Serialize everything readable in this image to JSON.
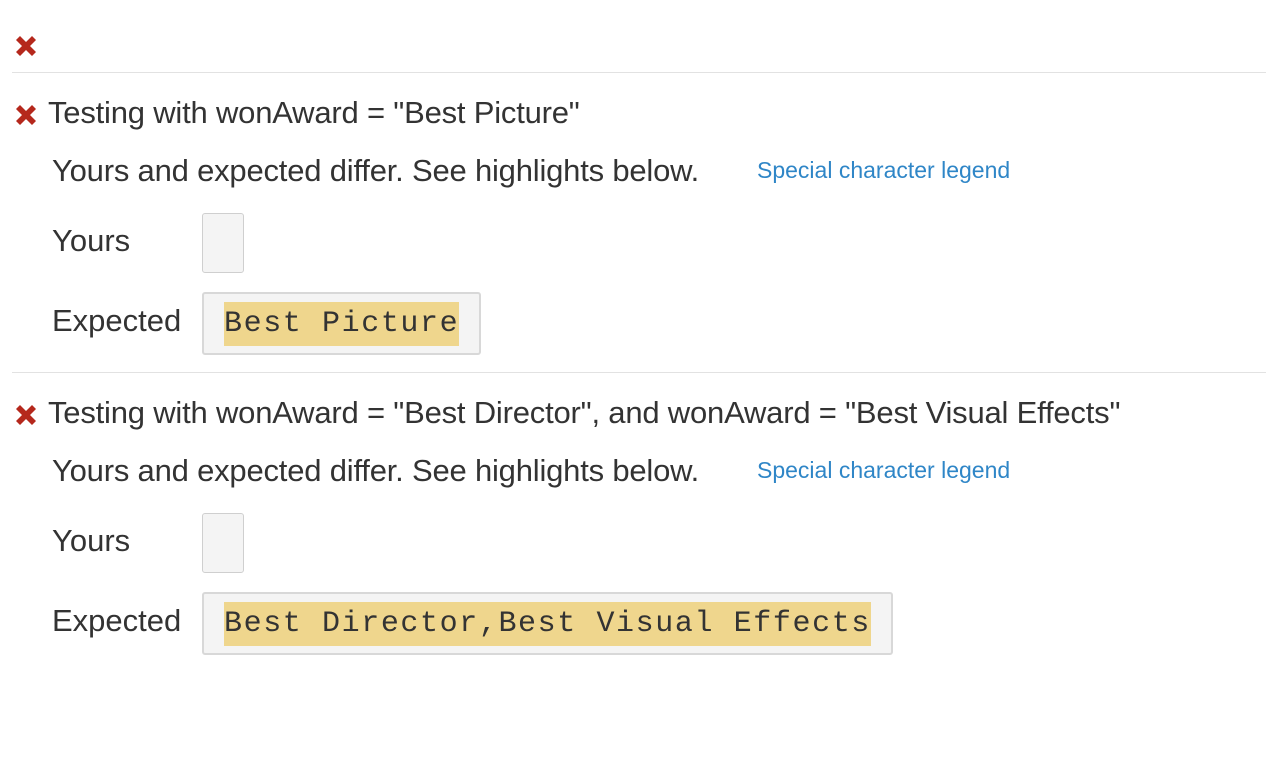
{
  "colors": {
    "error_icon": "#b5281c",
    "link": "#2f86c7",
    "highlight": "#efd68d",
    "box_bg": "#f4f4f4",
    "text": "#333333"
  },
  "icons": {
    "status": "x-mark-icon"
  },
  "tests": [
    {
      "title": "Testing with wonAward = \"Best Picture\"",
      "message": "Yours and expected differ. See highlights below.",
      "legend_link": "Special character legend",
      "yours_label": "Yours",
      "yours_value": "",
      "expected_label": "Expected",
      "expected_value": "Best Picture"
    },
    {
      "title": "Testing with wonAward = \"Best Director\", and wonAward = \"Best Visual Effects\"",
      "message": "Yours and expected differ. See highlights below.",
      "legend_link": "Special character legend",
      "yours_label": "Yours",
      "yours_value": "",
      "expected_label": "Expected",
      "expected_value": "Best Director,Best Visual Effects"
    }
  ]
}
